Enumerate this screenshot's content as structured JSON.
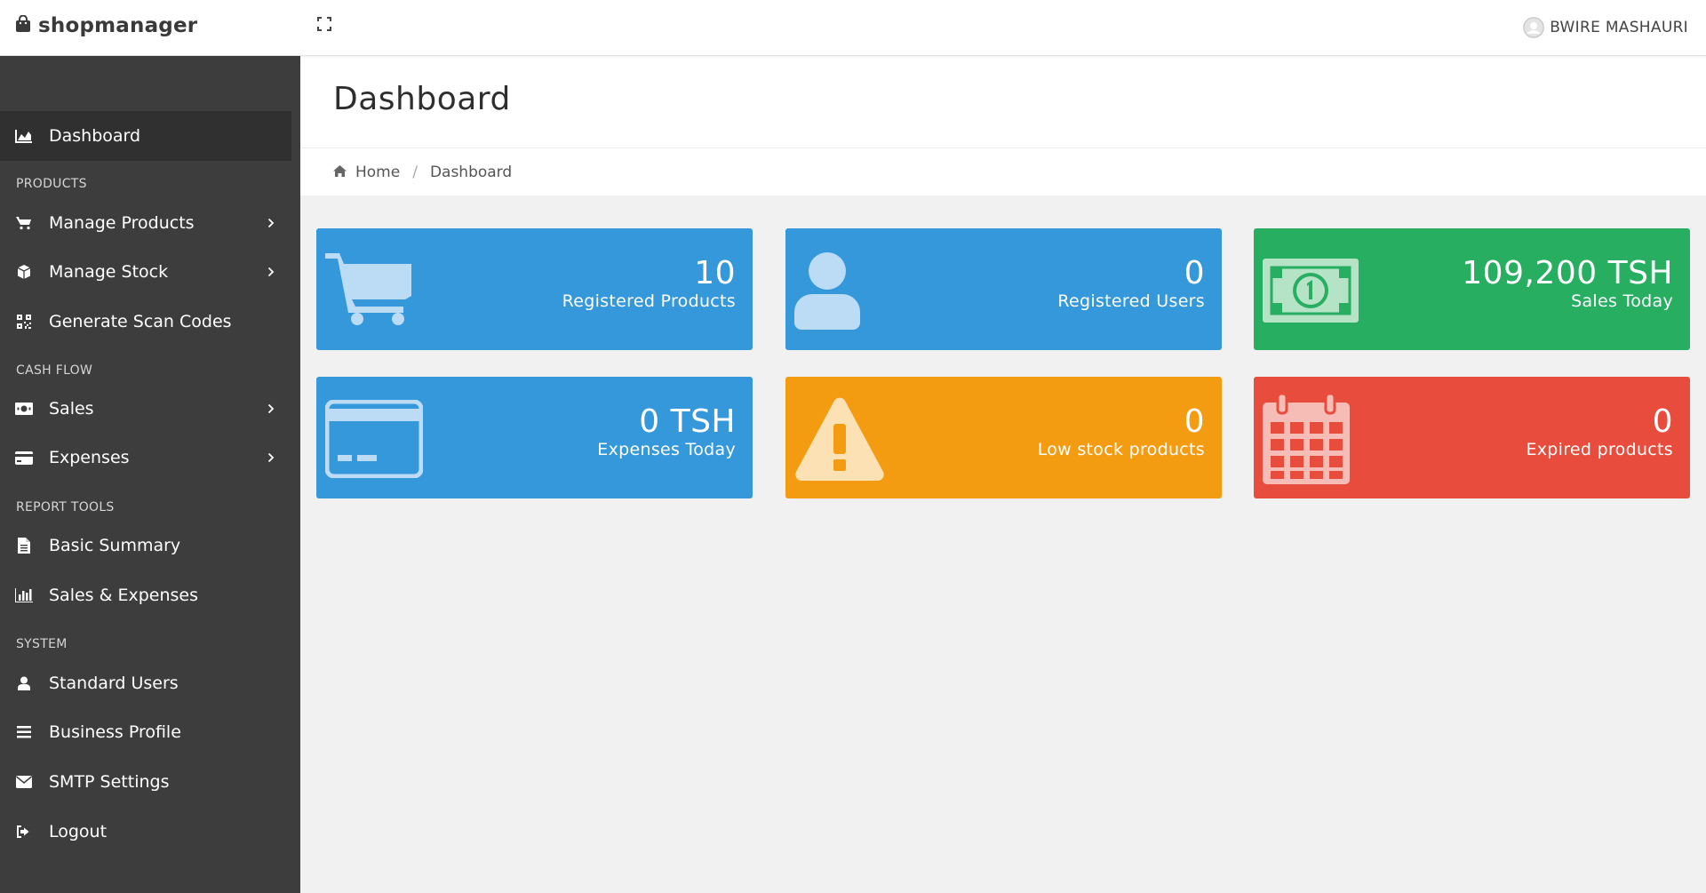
{
  "brand": {
    "name": "shopmanager"
  },
  "user": {
    "name": "BWIRE MASHAURI"
  },
  "sidebar": {
    "items": [
      {
        "label": "Dashboard",
        "icon": "area-chart-icon",
        "active": true
      },
      {
        "section": "PRODUCTS"
      },
      {
        "label": "Manage Products",
        "icon": "cart-icon",
        "has_submenu": true
      },
      {
        "label": "Manage Stock",
        "icon": "cube-icon",
        "has_submenu": true
      },
      {
        "label": "Generate Scan Codes",
        "icon": "qrcode-icon"
      },
      {
        "section": "CASH FLOW"
      },
      {
        "label": "Sales",
        "icon": "money-icon",
        "has_submenu": true
      },
      {
        "label": "Expenses",
        "icon": "credit-card-icon",
        "has_submenu": true
      },
      {
        "section": "REPORT TOOLS"
      },
      {
        "label": "Basic Summary",
        "icon": "file-text-icon"
      },
      {
        "label": "Sales & Expenses",
        "icon": "bar-chart-icon"
      },
      {
        "section": "SYSTEM"
      },
      {
        "label": "Standard Users",
        "icon": "user-icon"
      },
      {
        "label": "Business Profile",
        "icon": "bars-icon"
      },
      {
        "label": "SMTP Settings",
        "icon": "envelope-icon"
      },
      {
        "label": "Logout",
        "icon": "sign-out-icon"
      }
    ]
  },
  "page": {
    "title": "Dashboard",
    "breadcrumb": {
      "home": "Home",
      "current": "Dashboard"
    }
  },
  "cards": [
    {
      "value": "10",
      "label": "Registered Products",
      "color": "#3498db",
      "icon": "cart-icon"
    },
    {
      "value": "0",
      "label": "Registered Users",
      "color": "#3498db",
      "icon": "user-icon"
    },
    {
      "value": "109,200 TSH",
      "label": "Sales Today",
      "color": "#27ae60",
      "icon": "money-icon"
    },
    {
      "value": "0 TSH",
      "label": "Expenses Today",
      "color": "#3498db",
      "icon": "credit-card-icon"
    },
    {
      "value": "0",
      "label": "Low stock products",
      "color": "#f39c12",
      "icon": "warning-icon"
    },
    {
      "value": "0",
      "label": "Expired products",
      "color": "#e74c3c",
      "icon": "calendar-icon"
    }
  ]
}
